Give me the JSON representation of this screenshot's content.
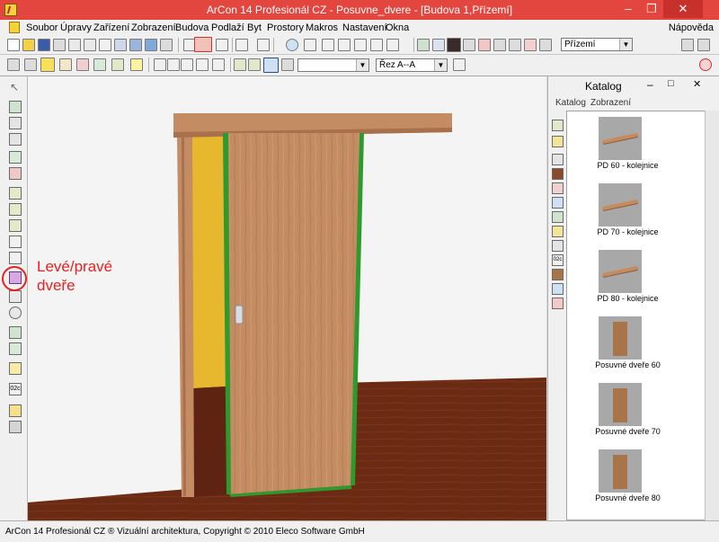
{
  "window": {
    "title": "ArCon 14 Profesionál CZ - Posuvne_dvere - [Budova 1,Přízemí]"
  },
  "menu": {
    "items": [
      "Soubor",
      "Úpravy",
      "Zařízení",
      "Zobrazení",
      "Budova",
      "Podlaží",
      "Byt",
      "Prostory",
      "Makros",
      "Nastavení",
      "Okna"
    ],
    "help": "Nápověda"
  },
  "toolbar": {
    "floor_select": "Přízemí",
    "section_select": "Řez A--A"
  },
  "annotation": {
    "line1": "Levé/pravé",
    "line2": "dveře",
    "color": "#e52222"
  },
  "catalog": {
    "title": "Katalog",
    "menu": [
      "Katalog",
      "Zobrazení"
    ],
    "items": [
      {
        "label": "PD 60 - kolejnice",
        "icon": "rail-icon"
      },
      {
        "label": "PD 70 - kolejnice",
        "icon": "rail-icon"
      },
      {
        "label": "PD 80 - kolejnice",
        "icon": "rail-icon"
      },
      {
        "label": "Posuvné dveře 60",
        "icon": "door-icon"
      },
      {
        "label": "Posuvné dveře 70",
        "icon": "door-icon"
      },
      {
        "label": "Posuvné dveře 80",
        "icon": "door-icon"
      }
    ]
  },
  "status": {
    "text": "ArCon 14 Profesionál CZ ® Vizuální architektura, Copyright © 2010 Eleco Software GmbH"
  },
  "colors": {
    "titlebar": "#e2463f",
    "wood": "#c48c63",
    "door_edge": "#2e9a2e",
    "floor": "#6b2a14",
    "wall_yellow": "#e7b82e"
  }
}
